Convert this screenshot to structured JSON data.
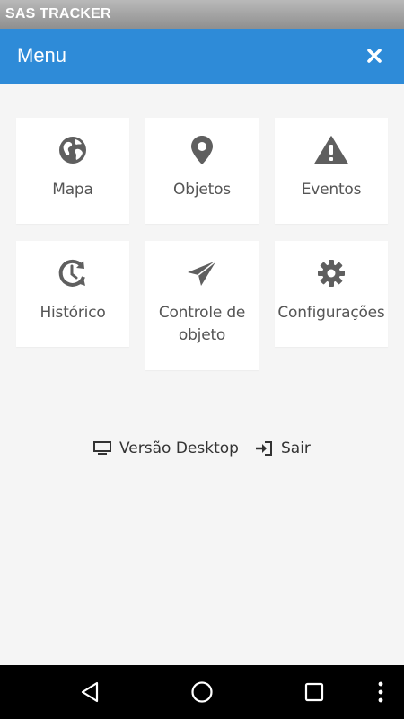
{
  "app": {
    "title": "SAS TRACKER"
  },
  "header": {
    "title": "Menu",
    "close_icon": "close-icon"
  },
  "menu": {
    "items": [
      {
        "label": "Mapa",
        "icon": "globe-icon"
      },
      {
        "label": "Objetos",
        "icon": "map-marker-icon"
      },
      {
        "label": "Eventos",
        "icon": "warning-icon"
      },
      {
        "label": "Histórico",
        "icon": "history-icon"
      },
      {
        "label": "Controle de objeto",
        "icon": "paper-plane-icon"
      },
      {
        "label": "Configurações",
        "icon": "gear-icon"
      }
    ]
  },
  "footer_links": {
    "desktop_label": "Versão Desktop",
    "logout_label": "Sair"
  },
  "colors": {
    "header": "#2e8bd8",
    "icon": "#5f5f5f",
    "text": "#555555",
    "background": "#f5f5f5"
  }
}
